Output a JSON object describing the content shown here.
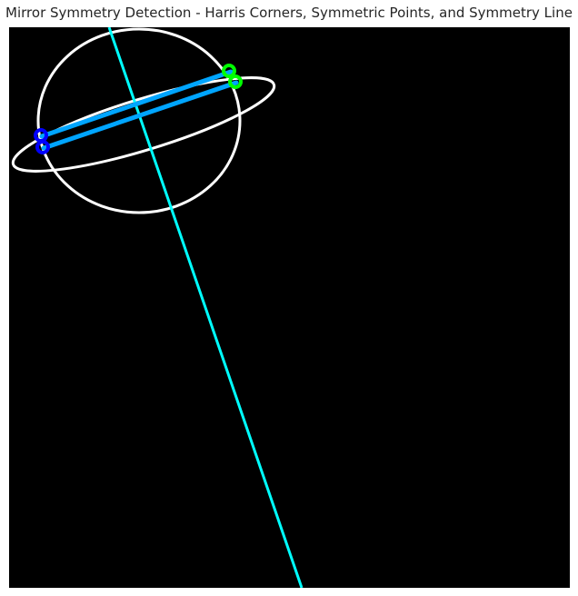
{
  "title": "Mirror Symmetry Detection - Harris Corners, Symmetric Points, and Symmetry Line",
  "colors": {
    "background": "#000000",
    "edges": "#ffffff",
    "symmetry_line": "#00ffff",
    "pair_lines": "#00a5ff",
    "points_left": "#0000ff",
    "points_right": "#00ff00"
  },
  "icons": [
    "planet-edge-outline",
    "symmetry-line",
    "point-pair-connector"
  ]
}
